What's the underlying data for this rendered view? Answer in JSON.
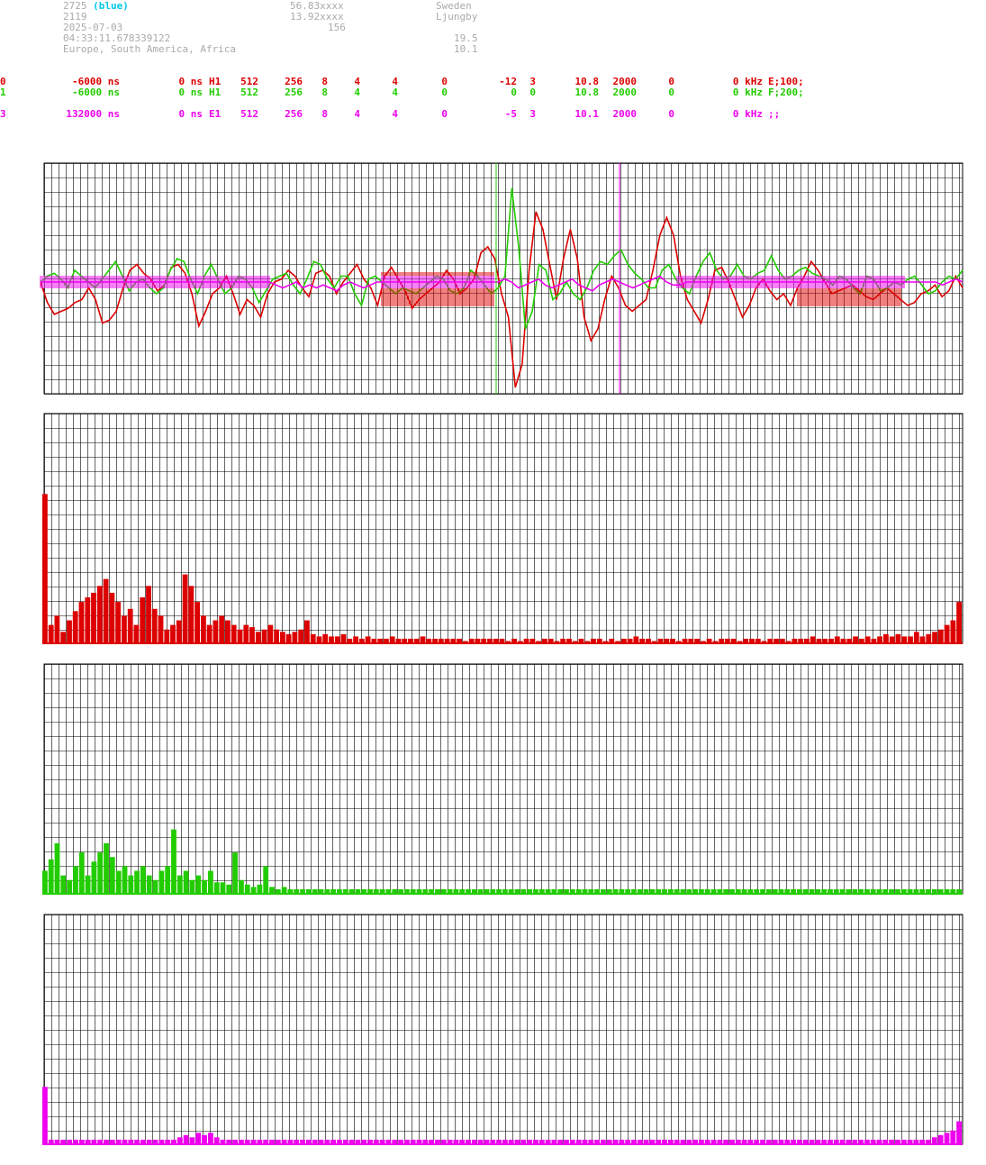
{
  "header": {
    "station_id": "2725",
    "station_tag": "(blue)",
    "lat": "56.83xxxx",
    "country": "Sweden",
    "code": "2119",
    "lon": "13.92xxxx",
    "city": "Ljungby",
    "date": "2025-07-03",
    "alt": "156",
    "time": "04:33:11.678339122",
    "val1": "19.5",
    "regions": "Europe, South America, Africa",
    "val2": "10.1"
  },
  "channels": [
    {
      "id": "0",
      "delay": "-6000 ns",
      "offset": "0 ns",
      "ant": "H1",
      "c1": "512",
      "c2": "256",
      "c3": "8",
      "c4": "4",
      "c5": "4",
      "c6": "0",
      "c7": "-12",
      "c8": "3",
      "freq": "10.8",
      "rate": "2000",
      "c9": "0",
      "khz": "0 kHz",
      "tag": "E;100;",
      "color": "#dd0000"
    },
    {
      "id": "1",
      "delay": "-6000 ns",
      "offset": "0 ns",
      "ant": "H1",
      "c1": "512",
      "c2": "256",
      "c3": "8",
      "c4": "4",
      "c5": "4",
      "c6": "0",
      "c7": "0",
      "c8": "0",
      "freq": "10.8",
      "rate": "2000",
      "c9": "0",
      "khz": "0 kHz",
      "tag": "F;200;",
      "color": "#22cc00"
    },
    {
      "id": "3",
      "delay": "132000 ns",
      "offset": "0 ns",
      "ant": "E1",
      "c1": "512",
      "c2": "256",
      "c3": "8",
      "c4": "4",
      "c5": "4",
      "c6": "0",
      "c7": "-5",
      "c8": "3",
      "freq": "10.1",
      "rate": "2000",
      "c9": "0",
      "khz": "0 kHz",
      "tag": ";;",
      "color": "#ee00ee"
    }
  ],
  "chart_data": [
    {
      "type": "line",
      "name": "waveform",
      "series": [
        {
          "color": "#dd0000",
          "values": [
            0,
            -0.35,
            -0.55,
            -0.5,
            -0.45,
            -0.35,
            -0.3,
            -0.1,
            -0.3,
            -0.7,
            -0.65,
            -0.5,
            -0.1,
            0.2,
            0.3,
            0.15,
            0.05,
            -0.15,
            -0.05,
            0.25,
            0.3,
            0.15,
            -0.2,
            -0.75,
            -0.5,
            -0.2,
            -0.1,
            0.1,
            -0.2,
            -0.55,
            -0.3,
            -0.4,
            -0.6,
            -0.2,
            0,
            0.05,
            0.2,
            0.1,
            -0.1,
            -0.25,
            0.15,
            0.2,
            0.1,
            -0.2,
            0,
            0.15,
            0.3,
            0.05,
            -0.1,
            -0.4,
            0.1,
            0.25,
            0.05,
            -0.15,
            -0.45,
            -0.3,
            -0.2,
            -0.1,
            0,
            0.2,
            0.05,
            -0.2,
            -0.1,
            0.05,
            0.5,
            0.6,
            0.4,
            -0.2,
            -0.6,
            -1.8,
            -1.4,
            0.2,
            1.2,
            0.9,
            0.3,
            -0.3,
            0.4,
            0.9,
            0.4,
            -0.6,
            -1.0,
            -0.8,
            -0.3,
            0.1,
            -0.1,
            -0.4,
            -0.5,
            -0.4,
            -0.3,
            0.2,
            0.8,
            1.1,
            0.8,
            0.1,
            -0.3,
            -0.5,
            -0.7,
            -0.3,
            0.2,
            0.25,
            0,
            -0.3,
            -0.6,
            -0.4,
            -0.1,
            0.05,
            -0.15,
            -0.3,
            -0.2,
            -0.4,
            -0.1,
            0.1,
            0.35,
            0.2,
            0,
            -0.2,
            -0.15,
            -0.1,
            -0.05,
            -0.15,
            -0.25,
            -0.3,
            -0.2,
            -0.1,
            -0.2,
            -0.3,
            -0.4,
            -0.35,
            -0.2,
            -0.15,
            -0.05,
            -0.25,
            -0.15,
            0.1,
            -0.1
          ]
        },
        {
          "color": "#22cc00",
          "values": [
            0,
            0.1,
            0.15,
            0.05,
            -0.1,
            0.2,
            0.1,
            0,
            -0.1,
            0.05,
            0.2,
            0.35,
            0.1,
            -0.15,
            0,
            0.05,
            -0.1,
            -0.2,
            -0.1,
            0.2,
            0.4,
            0.35,
            0.05,
            -0.2,
            0.1,
            0.3,
            0.05,
            -0.2,
            -0.1,
            0.1,
            0.05,
            -0.1,
            -0.35,
            -0.15,
            0.05,
            0.1,
            0.15,
            -0.05,
            -0.2,
            0.05,
            0.35,
            0.3,
            0.05,
            -0.1,
            0.1,
            0.1,
            -0.2,
            -0.4,
            0.05,
            0.1,
            0,
            -0.1,
            -0.2,
            -0.1,
            -0.15,
            -0.2,
            -0.1,
            0,
            0.1,
            0.05,
            -0.15,
            -0.2,
            -0.1,
            0.2,
            0.1,
            -0.05,
            -0.2,
            -0.1,
            0.1,
            1.6,
            0.6,
            -0.8,
            -0.5,
            0.3,
            0.2,
            -0.3,
            -0.2,
            0,
            -0.2,
            -0.3,
            -0.1,
            0.2,
            0.35,
            0.3,
            0.45,
            0.55,
            0.3,
            0.15,
            0.05,
            -0.1,
            -0.1,
            0.2,
            0.3,
            0.05,
            -0.1,
            -0.2,
            0.1,
            0.35,
            0.5,
            0.2,
            0.05,
            0.1,
            0.3,
            0.1,
            0.05,
            0.15,
            0.2,
            0.45,
            0.2,
            0.05,
            0.1,
            0.2,
            0.25,
            0.15,
            0.1,
            0.05,
            -0.05,
            0.1,
            0.05,
            -0.1,
            -0.2,
            0.1,
            0.05,
            -0.15,
            -0.1,
            0,
            -0.05,
            0.05,
            0.1,
            -0.05,
            -0.2,
            -0.15,
            0,
            0.1,
            0.05,
            0.2
          ]
        },
        {
          "color": "#ee00ee",
          "values": [
            0,
            0,
            0,
            0,
            0,
            0,
            0,
            0,
            0,
            0,
            0,
            0,
            0,
            0,
            0,
            0,
            0,
            0,
            0,
            0,
            0,
            0,
            0,
            0,
            0,
            0,
            0,
            0,
            0,
            0,
            0,
            0,
            0,
            0,
            0,
            -0.05,
            -0.1,
            -0.05,
            0,
            -0.1,
            -0.05,
            -0.1,
            -0.05,
            -0.1,
            -0.15,
            -0.05,
            0,
            -0.05,
            -0.1,
            -0.05,
            0,
            0,
            0,
            0,
            0,
            0,
            0,
            0,
            0,
            0,
            0,
            0,
            0,
            0,
            0,
            0,
            0,
            0,
            0,
            0.05,
            0,
            -0.1,
            -0.05,
            0,
            0.05,
            -0.05,
            -0.1,
            -0.05,
            0,
            0.05,
            -0.05,
            -0.1,
            -0.15,
            -0.05,
            0,
            0.05,
            0,
            -0.05,
            -0.1,
            -0.05,
            0,
            0.05,
            0.1,
            0,
            -0.05,
            -0.05,
            0,
            0,
            0,
            0,
            0,
            0,
            0,
            0,
            0,
            0,
            0,
            0,
            0,
            0,
            0,
            0,
            0,
            0,
            0,
            0,
            0,
            0,
            0,
            0,
            0,
            0,
            0,
            0,
            0,
            0,
            0,
            0,
            0,
            0,
            0,
            0,
            0,
            0,
            -0.05,
            0,
            0.05,
            0
          ]
        }
      ]
    },
    {
      "type": "bar",
      "name": "spectrum-red",
      "color": "#dd0000",
      "values": [
        0.65,
        0.08,
        0.12,
        0.05,
        0.1,
        0.14,
        0.18,
        0.2,
        0.22,
        0.25,
        0.28,
        0.22,
        0.18,
        0.12,
        0.15,
        0.08,
        0.2,
        0.25,
        0.15,
        0.12,
        0.06,
        0.08,
        0.1,
        0.3,
        0.25,
        0.18,
        0.12,
        0.08,
        0.1,
        0.12,
        0.1,
        0.08,
        0.06,
        0.08,
        0.07,
        0.05,
        0.06,
        0.08,
        0.06,
        0.05,
        0.04,
        0.05,
        0.06,
        0.1,
        0.04,
        0.03,
        0.04,
        0.03,
        0.03,
        0.04,
        0.02,
        0.03,
        0.02,
        0.03,
        0.02,
        0.02,
        0.02,
        0.03,
        0.02,
        0.02,
        0.02,
        0.02,
        0.03,
        0.02,
        0.02,
        0.02,
        0.02,
        0.02,
        0.02,
        0.01,
        0.02,
        0.02,
        0.02,
        0.02,
        0.02,
        0.02,
        0.01,
        0.02,
        0.01,
        0.02,
        0.02,
        0.01,
        0.02,
        0.02,
        0.01,
        0.02,
        0.02,
        0.01,
        0.02,
        0.01,
        0.02,
        0.02,
        0.01,
        0.02,
        0.01,
        0.02,
        0.02,
        0.03,
        0.02,
        0.02,
        0.01,
        0.02,
        0.02,
        0.02,
        0.01,
        0.02,
        0.02,
        0.02,
        0.01,
        0.02,
        0.01,
        0.02,
        0.02,
        0.02,
        0.01,
        0.02,
        0.02,
        0.02,
        0.01,
        0.02,
        0.02,
        0.02,
        0.01,
        0.02,
        0.02,
        0.02,
        0.03,
        0.02,
        0.02,
        0.02,
        0.03,
        0.02,
        0.02,
        0.03,
        0.02,
        0.03,
        0.02,
        0.03,
        0.04,
        0.03,
        0.04,
        0.03,
        0.03,
        0.05,
        0.03,
        0.04,
        0.05,
        0.06,
        0.08,
        0.1,
        0.18
      ]
    },
    {
      "type": "bar",
      "name": "spectrum-green",
      "color": "#22cc00",
      "values": [
        0.1,
        0.15,
        0.22,
        0.08,
        0.06,
        0.12,
        0.18,
        0.08,
        0.14,
        0.18,
        0.22,
        0.16,
        0.1,
        0.12,
        0.08,
        0.1,
        0.12,
        0.08,
        0.06,
        0.1,
        0.12,
        0.28,
        0.08,
        0.1,
        0.06,
        0.08,
        0.06,
        0.1,
        0.05,
        0.05,
        0.04,
        0.18,
        0.06,
        0.04,
        0.03,
        0.04,
        0.12,
        0.03,
        0.02,
        0.03,
        0.02,
        0.02,
        0.02,
        0.02,
        0.02,
        0.02,
        0.02,
        0.02,
        0.02,
        0.02,
        0.02,
        0.02,
        0.02,
        0.02,
        0.02,
        0.02,
        0.02,
        0.02,
        0.02,
        0.02,
        0.02,
        0.02,
        0.02,
        0.02,
        0.02,
        0.02,
        0.02,
        0.02,
        0.02,
        0.02,
        0.02,
        0.02,
        0.02,
        0.02,
        0.02,
        0.02,
        0.02,
        0.02,
        0.02,
        0.02,
        0.02,
        0.02,
        0.02,
        0.02,
        0.02,
        0.02,
        0.02,
        0.02,
        0.02,
        0.02,
        0.02,
        0.02,
        0.02,
        0.02,
        0.02,
        0.02,
        0.02,
        0.02,
        0.02,
        0.02,
        0.02,
        0.02,
        0.02,
        0.02,
        0.02,
        0.02,
        0.02,
        0.02,
        0.02,
        0.02,
        0.02,
        0.02,
        0.02,
        0.02,
        0.02,
        0.02,
        0.02,
        0.02,
        0.02,
        0.02,
        0.02,
        0.02,
        0.02,
        0.02,
        0.02,
        0.02,
        0.02,
        0.02,
        0.02,
        0.02,
        0.02,
        0.02,
        0.02,
        0.02,
        0.02,
        0.02,
        0.02,
        0.02,
        0.02,
        0.02,
        0.02,
        0.02,
        0.02,
        0.02,
        0.02,
        0.02,
        0.02,
        0.02,
        0.02,
        0.02
      ]
    },
    {
      "type": "bar",
      "name": "spectrum-magenta",
      "color": "#ee00ee",
      "values": [
        0.25,
        0.02,
        0.02,
        0.02,
        0.02,
        0.02,
        0.02,
        0.02,
        0.02,
        0.02,
        0.02,
        0.02,
        0.02,
        0.02,
        0.02,
        0.02,
        0.02,
        0.02,
        0.02,
        0.02,
        0.02,
        0.02,
        0.03,
        0.04,
        0.03,
        0.05,
        0.04,
        0.05,
        0.03,
        0.02,
        0.02,
        0.02,
        0.02,
        0.02,
        0.02,
        0.02,
        0.02,
        0.02,
        0.02,
        0.02,
        0.02,
        0.02,
        0.02,
        0.02,
        0.02,
        0.02,
        0.02,
        0.02,
        0.02,
        0.02,
        0.02,
        0.02,
        0.02,
        0.02,
        0.02,
        0.02,
        0.02,
        0.02,
        0.02,
        0.02,
        0.02,
        0.02,
        0.02,
        0.02,
        0.02,
        0.02,
        0.02,
        0.02,
        0.02,
        0.02,
        0.02,
        0.02,
        0.02,
        0.02,
        0.02,
        0.02,
        0.02,
        0.02,
        0.02,
        0.02,
        0.02,
        0.02,
        0.02,
        0.02,
        0.02,
        0.02,
        0.02,
        0.02,
        0.02,
        0.02,
        0.02,
        0.02,
        0.02,
        0.02,
        0.02,
        0.02,
        0.02,
        0.02,
        0.02,
        0.02,
        0.02,
        0.02,
        0.02,
        0.02,
        0.02,
        0.02,
        0.02,
        0.02,
        0.02,
        0.02,
        0.02,
        0.02,
        0.02,
        0.02,
        0.02,
        0.02,
        0.02,
        0.02,
        0.02,
        0.02,
        0.02,
        0.02,
        0.02,
        0.02,
        0.02,
        0.02,
        0.02,
        0.02,
        0.02,
        0.02,
        0.02,
        0.02,
        0.02,
        0.02,
        0.02,
        0.02,
        0.02,
        0.02,
        0.02,
        0.02,
        0.02,
        0.02,
        0.02,
        0.02,
        0.02,
        0.03,
        0.04,
        0.05,
        0.06,
        0.1
      ]
    }
  ]
}
